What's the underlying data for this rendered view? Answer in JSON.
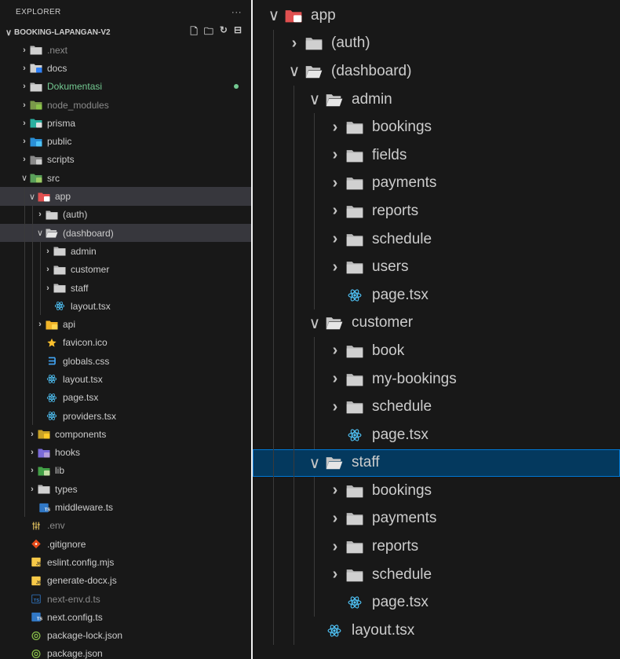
{
  "explorer": {
    "title": "EXPLORER",
    "more": "···",
    "project": "BOOKING-LAPANGAN-V2",
    "actions": [
      "new-file-icon",
      "new-folder-icon",
      "refresh-icon",
      "collapse-all-icon"
    ]
  },
  "left_tree": [
    {
      "label": ".next",
      "depth": 0,
      "kind": "folder",
      "open": false,
      "icon": "folder-icon",
      "dim": true
    },
    {
      "label": "docs",
      "depth": 0,
      "kind": "folder",
      "open": false,
      "icon": "docs-folder-icon"
    },
    {
      "label": "Dokumentasi",
      "depth": 0,
      "kind": "folder",
      "open": false,
      "icon": "folder-icon",
      "modified": true
    },
    {
      "label": "node_modules",
      "depth": 0,
      "kind": "folder",
      "open": false,
      "icon": "node-modules-folder-icon",
      "dim": true
    },
    {
      "label": "prisma",
      "depth": 0,
      "kind": "folder",
      "open": false,
      "icon": "prisma-folder-icon"
    },
    {
      "label": "public",
      "depth": 0,
      "kind": "folder",
      "open": false,
      "icon": "public-folder-icon"
    },
    {
      "label": "scripts",
      "depth": 0,
      "kind": "folder",
      "open": false,
      "icon": "scripts-folder-icon"
    },
    {
      "label": "src",
      "depth": 0,
      "kind": "folder",
      "open": true,
      "icon": "src-folder-icon"
    },
    {
      "label": "app",
      "depth": 1,
      "kind": "folder",
      "open": true,
      "icon": "app-folder-icon",
      "selected": true
    },
    {
      "label": "(auth)",
      "depth": 2,
      "kind": "folder",
      "open": false,
      "icon": "folder-icon"
    },
    {
      "label": "(dashboard)",
      "depth": 2,
      "kind": "folder",
      "open": true,
      "icon": "folder-open-icon",
      "selected": true
    },
    {
      "label": "admin",
      "depth": 3,
      "kind": "folder",
      "open": false,
      "icon": "folder-icon"
    },
    {
      "label": "customer",
      "depth": 3,
      "kind": "folder",
      "open": false,
      "icon": "folder-icon"
    },
    {
      "label": "staff",
      "depth": 3,
      "kind": "folder",
      "open": false,
      "icon": "folder-icon"
    },
    {
      "label": "layout.tsx",
      "depth": 3,
      "kind": "file",
      "icon": "react-icon"
    },
    {
      "label": "api",
      "depth": 2,
      "kind": "folder",
      "open": false,
      "icon": "api-folder-icon"
    },
    {
      "label": "favicon.ico",
      "depth": 2,
      "kind": "file",
      "icon": "star-icon"
    },
    {
      "label": "globals.css",
      "depth": 2,
      "kind": "file",
      "icon": "css-icon"
    },
    {
      "label": "layout.tsx",
      "depth": 2,
      "kind": "file",
      "icon": "react-icon"
    },
    {
      "label": "page.tsx",
      "depth": 2,
      "kind": "file",
      "icon": "react-icon"
    },
    {
      "label": "providers.tsx",
      "depth": 2,
      "kind": "file",
      "icon": "react-icon"
    },
    {
      "label": "components",
      "depth": 1,
      "kind": "folder",
      "open": false,
      "icon": "components-folder-icon"
    },
    {
      "label": "hooks",
      "depth": 1,
      "kind": "folder",
      "open": false,
      "icon": "hooks-folder-icon"
    },
    {
      "label": "lib",
      "depth": 1,
      "kind": "folder",
      "open": false,
      "icon": "lib-folder-icon"
    },
    {
      "label": "types",
      "depth": 1,
      "kind": "folder",
      "open": false,
      "icon": "folder-icon"
    },
    {
      "label": "middleware.ts",
      "depth": 1,
      "kind": "file",
      "icon": "typescript-icon"
    },
    {
      "label": ".env",
      "depth": 0,
      "kind": "file",
      "icon": "env-icon",
      "dim": true
    },
    {
      "label": ".gitignore",
      "depth": 0,
      "kind": "file",
      "icon": "git-icon"
    },
    {
      "label": "eslint.config.mjs",
      "depth": 0,
      "kind": "file",
      "icon": "javascript-icon"
    },
    {
      "label": "generate-docx.js",
      "depth": 0,
      "kind": "file",
      "icon": "javascript-icon"
    },
    {
      "label": "next-env.d.ts",
      "depth": 0,
      "kind": "file",
      "icon": "typescript-def-icon",
      "dim": true
    },
    {
      "label": "next.config.ts",
      "depth": 0,
      "kind": "file",
      "icon": "typescript-icon"
    },
    {
      "label": "package-lock.json",
      "depth": 0,
      "kind": "file",
      "icon": "npm-json-icon"
    },
    {
      "label": "package.json",
      "depth": 0,
      "kind": "file",
      "icon": "npm-json-icon"
    }
  ],
  "right_tree": [
    {
      "label": "app",
      "depth": 0,
      "kind": "folder",
      "open": true,
      "icon": "app-folder-icon"
    },
    {
      "label": "(auth)",
      "depth": 1,
      "kind": "folder",
      "open": false,
      "icon": "folder-icon"
    },
    {
      "label": "(dashboard)",
      "depth": 1,
      "kind": "folder",
      "open": true,
      "icon": "folder-open-icon"
    },
    {
      "label": "admin",
      "depth": 2,
      "kind": "folder",
      "open": true,
      "icon": "folder-open-icon"
    },
    {
      "label": "bookings",
      "depth": 3,
      "kind": "folder",
      "open": false,
      "icon": "folder-icon"
    },
    {
      "label": "fields",
      "depth": 3,
      "kind": "folder",
      "open": false,
      "icon": "folder-icon"
    },
    {
      "label": "payments",
      "depth": 3,
      "kind": "folder",
      "open": false,
      "icon": "folder-icon"
    },
    {
      "label": "reports",
      "depth": 3,
      "kind": "folder",
      "open": false,
      "icon": "folder-icon"
    },
    {
      "label": "schedule",
      "depth": 3,
      "kind": "folder",
      "open": false,
      "icon": "folder-icon"
    },
    {
      "label": "users",
      "depth": 3,
      "kind": "folder",
      "open": false,
      "icon": "folder-icon"
    },
    {
      "label": "page.tsx",
      "depth": 3,
      "kind": "file",
      "icon": "react-icon"
    },
    {
      "label": "customer",
      "depth": 2,
      "kind": "folder",
      "open": true,
      "icon": "folder-open-icon"
    },
    {
      "label": "book",
      "depth": 3,
      "kind": "folder",
      "open": false,
      "icon": "folder-icon"
    },
    {
      "label": "my-bookings",
      "depth": 3,
      "kind": "folder",
      "open": false,
      "icon": "folder-icon"
    },
    {
      "label": "schedule",
      "depth": 3,
      "kind": "folder",
      "open": false,
      "icon": "folder-icon"
    },
    {
      "label": "page.tsx",
      "depth": 3,
      "kind": "file",
      "icon": "react-icon"
    },
    {
      "label": "staff",
      "depth": 2,
      "kind": "folder",
      "open": true,
      "icon": "folder-open-icon",
      "selected": true
    },
    {
      "label": "bookings",
      "depth": 3,
      "kind": "folder",
      "open": false,
      "icon": "folder-icon"
    },
    {
      "label": "payments",
      "depth": 3,
      "kind": "folder",
      "open": false,
      "icon": "folder-icon"
    },
    {
      "label": "reports",
      "depth": 3,
      "kind": "folder",
      "open": false,
      "icon": "folder-icon"
    },
    {
      "label": "schedule",
      "depth": 3,
      "kind": "folder",
      "open": false,
      "icon": "folder-icon"
    },
    {
      "label": "page.tsx",
      "depth": 3,
      "kind": "file",
      "icon": "react-icon"
    },
    {
      "label": "layout.tsx",
      "depth": 2,
      "kind": "file",
      "icon": "react-icon"
    }
  ]
}
